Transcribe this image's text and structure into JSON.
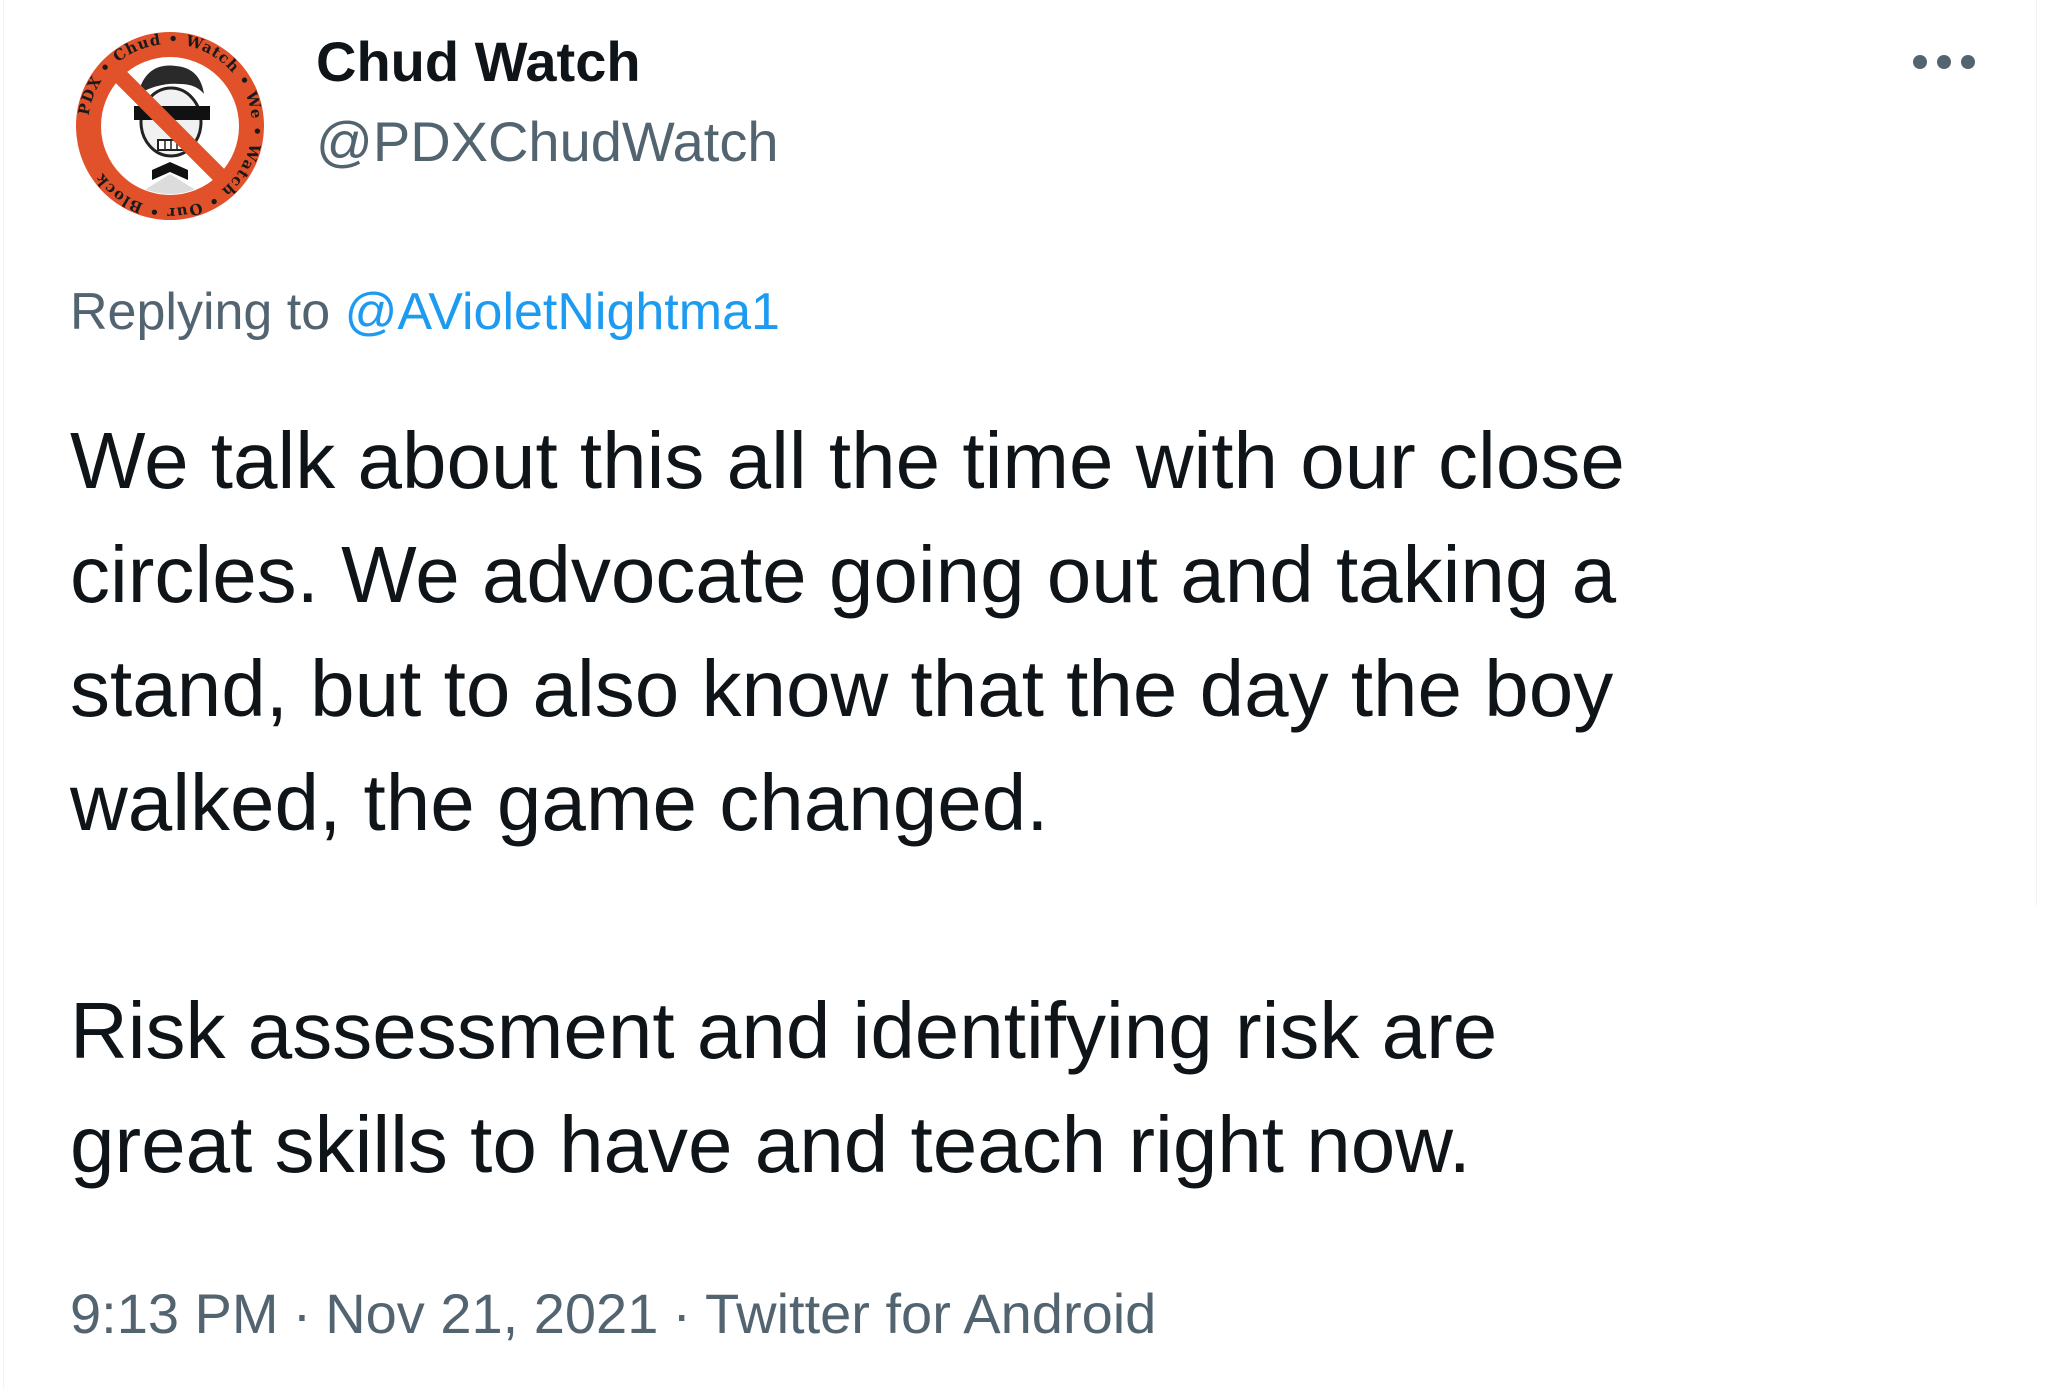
{
  "author": {
    "display_name": "Chud Watch",
    "handle": "@PDXChudWatch",
    "avatar_icon": "no-symbol-logo-icon",
    "avatar_ring_text": "PDX • Chud • Watch • We • Watch • Our • Block"
  },
  "reply": {
    "prefix": "Replying to",
    "mention": "@AVioletNightma1"
  },
  "body": {
    "paragraph_1": "We talk about this all the time with our close\ncircles. We advocate going out and taking a\nstand, but to also know that the day the boy\nwalked, the game changed.",
    "paragraph_2": "Risk assessment and identifying risk are\ngreat skills to have and teach right now."
  },
  "meta": {
    "time": "9:13 PM",
    "date": "Nov 21, 2021",
    "source": "Twitter for Android",
    "separator": "·"
  },
  "icons": {
    "more": "more-dots-icon"
  },
  "colors": {
    "text_primary": "#0f1419",
    "text_secondary": "#536471",
    "link": "#1d9bf0",
    "avatar_ring": "#e1512a"
  }
}
